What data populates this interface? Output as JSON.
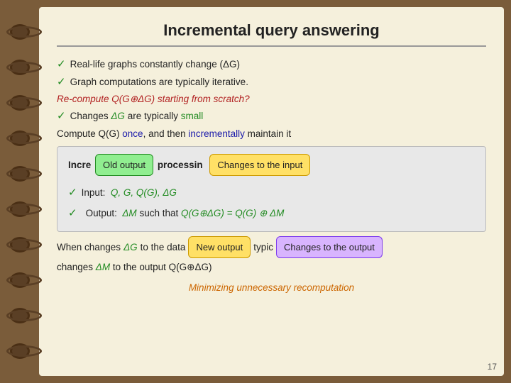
{
  "page": {
    "title": "Incremental query answering",
    "bullet1": "Real-life graphs constantly change (ΔG)",
    "bullet2": "Graph computations are typically iterative.",
    "italic_line": "Re-compute Q(G⊕ΔG) starting from scratch?",
    "bullet3_prefix": "Changes ",
    "bullet3_delta": "ΔG",
    "bullet3_suffix": " are typically ",
    "bullet3_small": "small",
    "line4_prefix": "Compute Q(G) ",
    "line4_once": "once",
    "line4_mid": ", and then ",
    "line4_incr": "incrementally",
    "line4_suffix": " maintain it",
    "incr_header": "Incremental query processing",
    "bubble_old_output": "Old output",
    "bubble_changes_input": "Changes to the input",
    "input_label": "Input:",
    "input_vars": "Q,  G,  Q(G),  ΔG",
    "output_label": "Output:",
    "output_delta": "ΔM",
    "output_mid": " such that  ",
    "output_formula": "Q(G⊕ΔG) = Q(G) ⊕ ΔM",
    "when_prefix": "When changes ",
    "when_delta": "ΔG",
    "when_mid": " to the data",
    "bubble_new_output": "New output",
    "when_typic": "typic",
    "bubble_changes_output": "Changes to the output",
    "changes_m_prefix": "  changes ",
    "changes_m_delta": "ΔM",
    "changes_m_suffix": " to the output Q(G⊕ΔG)",
    "minimizing": "Minimizing unnecessary recomputation",
    "page_number": "17"
  }
}
